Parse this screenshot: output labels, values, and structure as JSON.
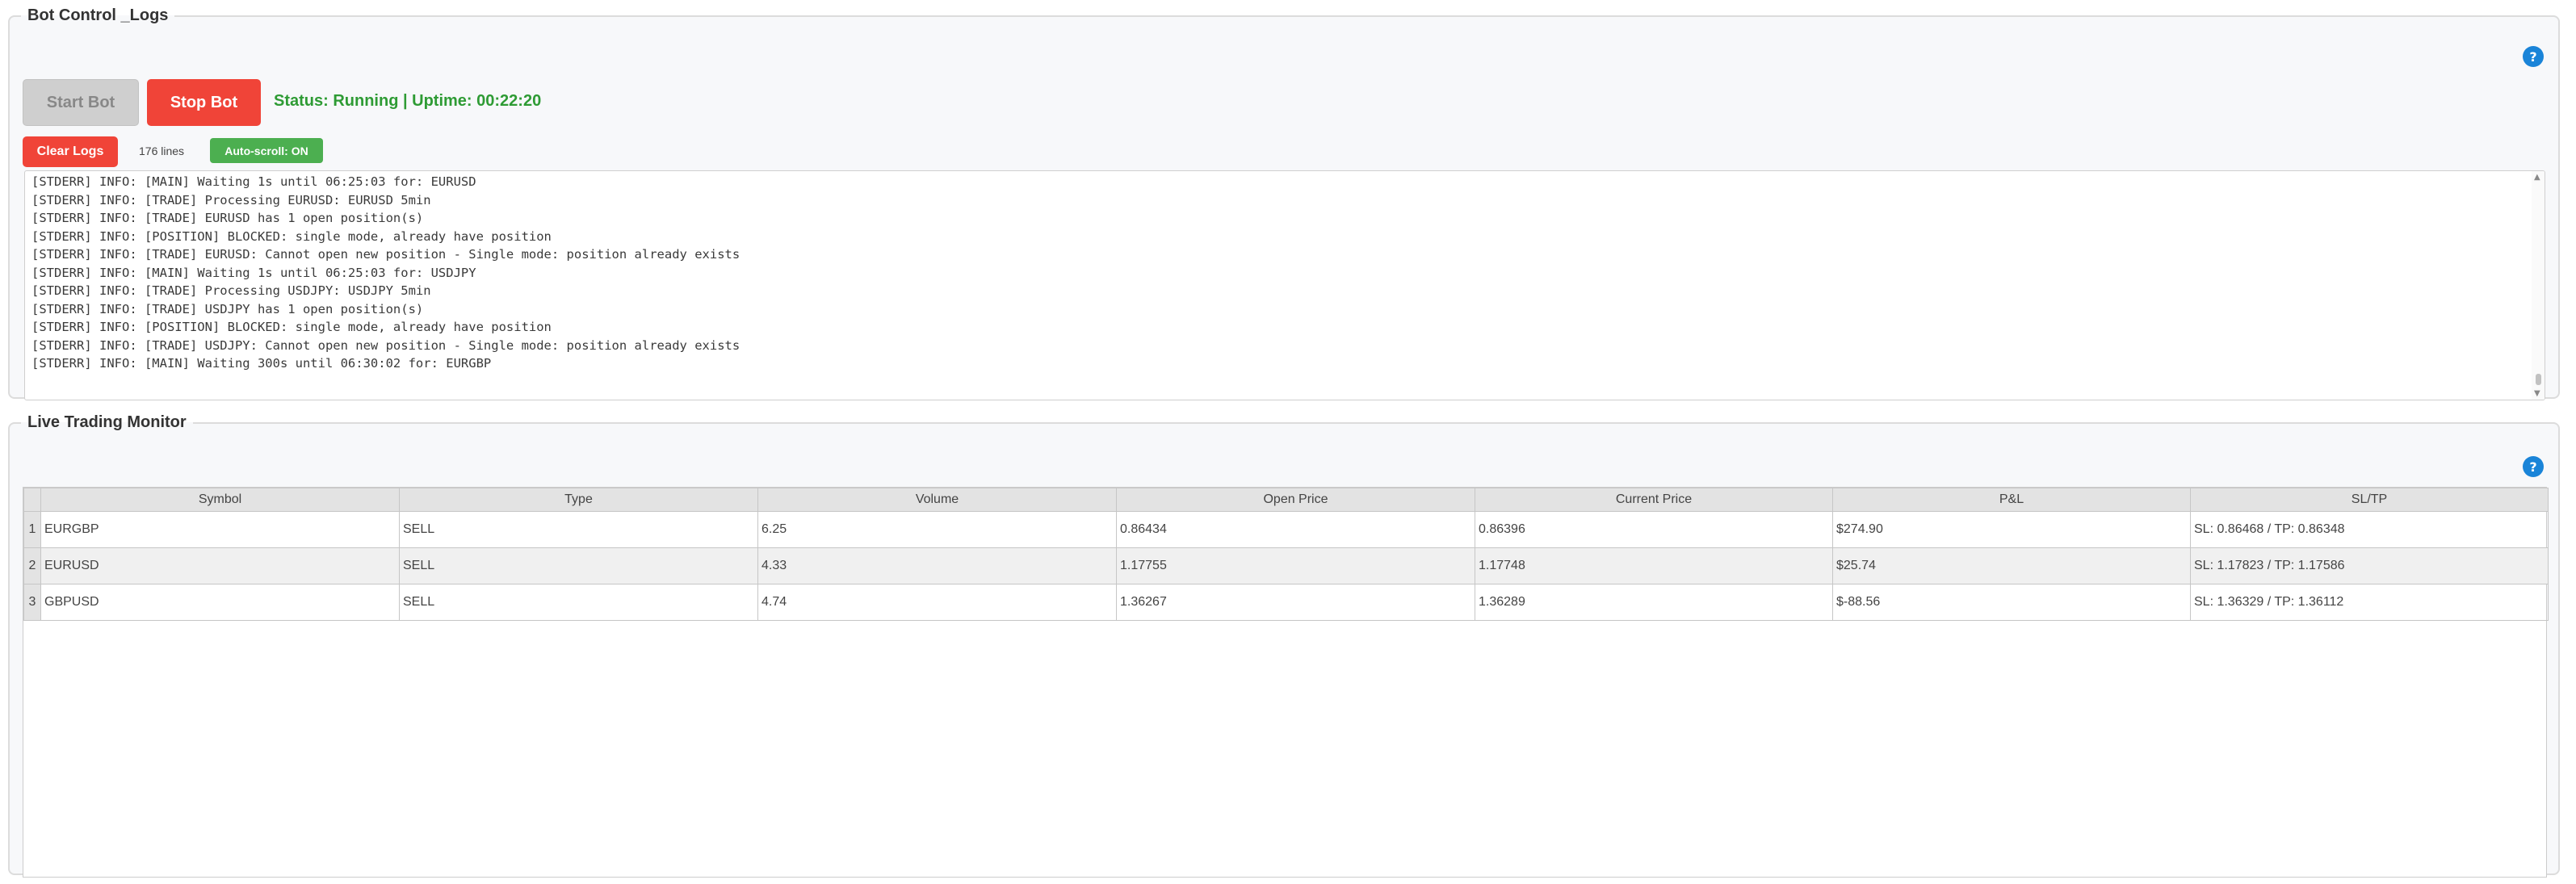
{
  "bot_control": {
    "title": "Bot Control _Logs",
    "help_label": "?",
    "start_label": "Start Bot",
    "stop_label": "Stop Bot",
    "status_text": "Status: Running | Uptime: 00:22:20",
    "clear_label": "Clear Logs",
    "line_count": "176 lines",
    "autoscroll_label": "Auto-scroll: ON",
    "logs": [
      "[STDERR] INFO: [MAIN] Waiting 1s until 06:25:03 for: EURUSD",
      "[STDERR] INFO: [TRADE] Processing EURUSD: EURUSD 5min",
      "[STDERR] INFO: [TRADE] EURUSD has 1 open position(s)",
      "[STDERR] INFO: [POSITION] BLOCKED: single mode, already have position",
      "[STDERR] INFO: [TRADE] EURUSD: Cannot open new position - Single mode: position already exists",
      "[STDERR] INFO: [MAIN] Waiting 1s until 06:25:03 for: USDJPY",
      "[STDERR] INFO: [TRADE] Processing USDJPY: USDJPY 5min",
      "[STDERR] INFO: [TRADE] USDJPY has 1 open position(s)",
      "[STDERR] INFO: [POSITION] BLOCKED: single mode, already have position",
      "[STDERR] INFO: [TRADE] USDJPY: Cannot open new position - Single mode: position already exists",
      "[STDERR] INFO: [MAIN] Waiting 300s until 06:30:02 for: EURGBP"
    ],
    "colors": {
      "stop": "#f04438",
      "autoscroll": "#4caf50",
      "status": "#2e9b34"
    }
  },
  "monitor": {
    "title": "Live Trading Monitor",
    "help_label": "?",
    "columns": [
      "Symbol",
      "Type",
      "Volume",
      "Open Price",
      "Current Price",
      "P&L",
      "SL/TP"
    ],
    "rows": [
      {
        "idx": "1",
        "symbol": "EURGBP",
        "type": "SELL",
        "volume": "6.25",
        "open": "0.86434",
        "current": "0.86396",
        "pnl": "$274.90",
        "pnl_sign": "pos",
        "sltp": "SL: 0.86468 / TP: 0.86348"
      },
      {
        "idx": "2",
        "symbol": "EURUSD",
        "type": "SELL",
        "volume": "4.33",
        "open": "1.17755",
        "current": "1.17748",
        "pnl": "$25.74",
        "pnl_sign": "pos",
        "sltp": "SL: 1.17823 / TP: 1.17586"
      },
      {
        "idx": "3",
        "symbol": "GBPUSD",
        "type": "SELL",
        "volume": "4.74",
        "open": "1.36267",
        "current": "1.36289",
        "pnl": "$-88.56",
        "pnl_sign": "neg",
        "sltp": "SL: 1.36329 / TP: 1.36112"
      }
    ],
    "colors": {
      "positive": "#22d422",
      "negative": "#e8221a"
    }
  }
}
